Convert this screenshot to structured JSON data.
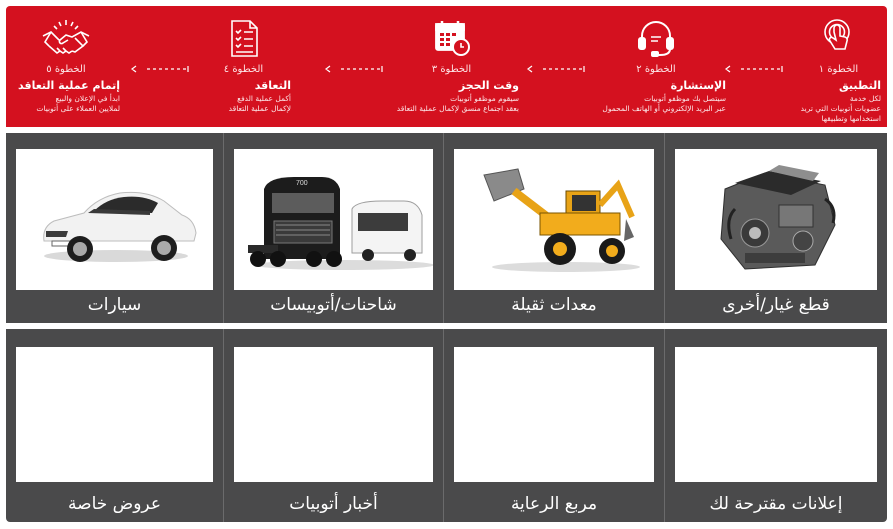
{
  "steps": [
    {
      "num": "الخطوة ١",
      "title": "التطبيق",
      "desc": "لكل خدمة\nعضويات أتوبيات التي تريد\nاستخدامها وتطبيقها",
      "icon": "touch-icon"
    },
    {
      "num": "الخطوة ٢",
      "title": "الإستشارة",
      "desc": "سيتصل بك موظفو أتوبيات\nعبر البريد الإلكتروني أو الهاتف المحمول",
      "icon": "headset-icon"
    },
    {
      "num": "الخطوة ٣",
      "title": "وقت الحجز",
      "desc": "سيقوم موظفو أتوبيات\nبعقد اجتماع منسق لإكمال عملية التعاقد",
      "icon": "calendar-icon"
    },
    {
      "num": "الخطوة ٤",
      "title": "التعاقد",
      "desc": "أكمل عملية الدفع\nلإكمال عملية التعاقد",
      "icon": "contract-icon"
    },
    {
      "num": "الخطوة ٥",
      "title": "إتمام عملية التعاقد",
      "desc": "ابدأ في الإعلان والبيع\nلملايين العملاء على أتوبيات",
      "icon": "handshake-icon"
    }
  ],
  "categories_top": [
    {
      "label": "قطع غيار/أخرى",
      "icon": "engine-icon"
    },
    {
      "label": "معدات ثقيلة",
      "icon": "backhoe-loader-icon"
    },
    {
      "label": "شاحنات/أتوبيسات",
      "icon": "truck-bus-icon"
    },
    {
      "label": "سيارات",
      "icon": "car-icon"
    }
  ],
  "categories_bottom": [
    {
      "label": "إعلانات مقترحة لك"
    },
    {
      "label": "مربع الرعاية"
    },
    {
      "label": "أخبار أتوبيات"
    },
    {
      "label": "عروض خاصة"
    }
  ],
  "colors": {
    "banner": "#d4111f",
    "tiles": "#4a4a4b",
    "text": "#ffffff"
  }
}
